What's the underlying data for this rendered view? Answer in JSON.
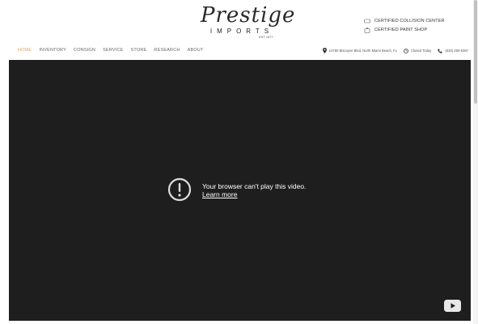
{
  "logo": {
    "script": "Prestige",
    "sub": "IMPORTS",
    "est": "EST 1977"
  },
  "certifications": [
    {
      "icon": "car-icon",
      "label": "CERTIFIED COLLISION CENTER"
    },
    {
      "icon": "spray-paint-icon",
      "label": "CERTIFIED PAINT SHOP"
    }
  ],
  "nav": {
    "items": [
      {
        "label": "HOME",
        "active": true
      },
      {
        "label": "INVENTORY"
      },
      {
        "label": "CONSIGN"
      },
      {
        "label": "SERVICE"
      },
      {
        "label": "STORE"
      },
      {
        "label": "RESEARCH"
      },
      {
        "label": "ABOUT"
      }
    ]
  },
  "info": {
    "address": "14780 Biscayne Blvd, North Miami Beach, FL",
    "hours": "Closed Today",
    "phone": "(833) 290-6367"
  },
  "video": {
    "message": "Your browser can't play this video.",
    "link": "Learn more"
  },
  "colors": {
    "accent": "#e3a462",
    "video_bg": "#1e1e1e",
    "header_bg": "#ffffff"
  }
}
